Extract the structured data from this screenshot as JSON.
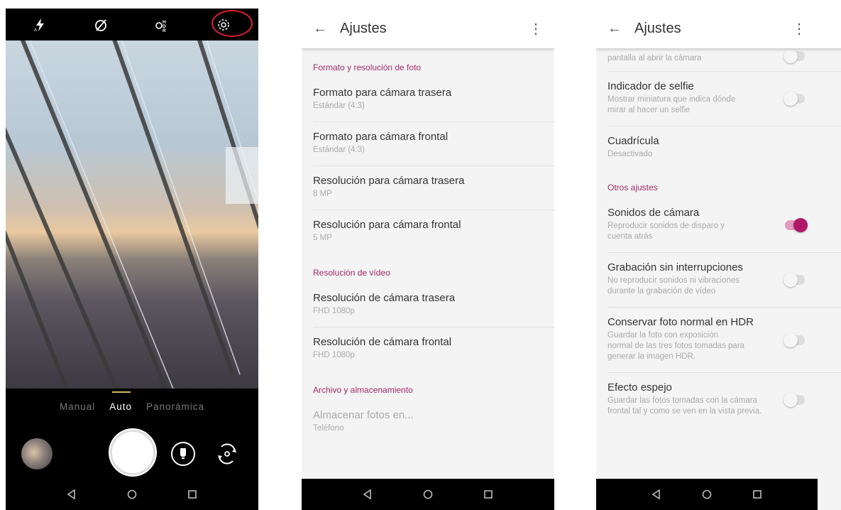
{
  "camera": {
    "modes": [
      "Manual",
      "Auto",
      "Panorámica"
    ]
  },
  "settings_left": {
    "title": "Ajustes",
    "sections": [
      {
        "header": "Formato y resolución de foto",
        "items": [
          {
            "title": "Formato para cámara trasera",
            "sub": "Estándar (4:3)"
          },
          {
            "title": "Formato para cámara frontal",
            "sub": "Estándar (4:3)"
          },
          {
            "title": "Resolución para cámara trasera",
            "sub": "8 MP"
          },
          {
            "title": "Resolución para cámara frontal",
            "sub": "5 MP"
          }
        ]
      },
      {
        "header": "Resolución de vídeo",
        "items": [
          {
            "title": "Resolución de cámara trasera",
            "sub": "FHD 1080p"
          },
          {
            "title": "Resolución de cámara frontal",
            "sub": "FHD 1080p"
          }
        ]
      },
      {
        "header": "Archivo y almacenamiento",
        "items": [
          {
            "title": "Almacenar fotos en...",
            "sub": "Teléfono"
          }
        ]
      }
    ]
  },
  "settings_right": {
    "title": "Ajustes",
    "top_partial": "pantalla al abrir la cámara",
    "items1": [
      {
        "title": "Indicador de selfie",
        "sub": "Mostrar miniatura que indica dónde mirar al hacer un selfie"
      },
      {
        "title": "Cuadrícula",
        "sub": "Desactivado"
      }
    ],
    "section": "Otros ajustes",
    "items2": [
      {
        "title": "Sonidos de cámara",
        "sub": "Reproducir sonidos de disparo y cuenta atrás"
      },
      {
        "title": "Grabación sin interrupciones",
        "sub": "No reproducir sonidos ni vibraciones durante la grabación de vídeo"
      },
      {
        "title": "Conservar foto normal en HDR",
        "sub": "Guardar la foto con exposición normal de las tres fotos tomadas para generar la imagen HDR."
      },
      {
        "title": "Efecto espejo",
        "sub": "Guardar las fotos tomadas con la cámara frontal tal y como se ven en la vista previa."
      }
    ]
  }
}
